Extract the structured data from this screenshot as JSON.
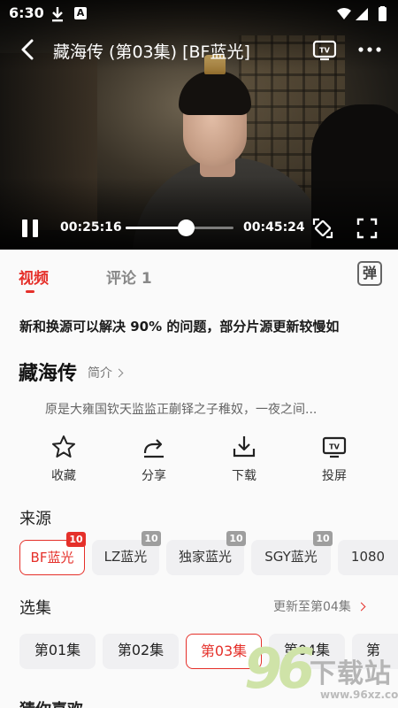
{
  "status_bar": {
    "time": "6:30",
    "icons": [
      "download-icon",
      "a-badge-icon",
      "wifi-icon",
      "signal-icon",
      "battery-icon"
    ]
  },
  "player": {
    "title": "藏海传 (第03集) [BF蓝光]",
    "current_time": "00:25:16",
    "total_time": "00:45:24",
    "progress_fraction": 0.556,
    "icons": [
      "back-icon",
      "tv-cast-icon",
      "more-icon",
      "pause-icon",
      "rotate-icon",
      "fullscreen-icon"
    ]
  },
  "tabs": {
    "video": "视频",
    "comment": "评论 1",
    "danmaku": "弹"
  },
  "notice": "新和换源可以解决 90% 的问题，部分片源更新较慢如",
  "show": {
    "title": "藏海传",
    "intro_label": "简介",
    "description": "原是大雍国钦天监监正蒯铎之子稚奴，一夜之间..."
  },
  "actions": [
    {
      "label": "收藏",
      "icon": "star-icon"
    },
    {
      "label": "分享",
      "icon": "share-icon"
    },
    {
      "label": "下载",
      "icon": "download-icon"
    },
    {
      "label": "投屏",
      "icon": "tv-icon"
    }
  ],
  "sources": {
    "label": "来源",
    "items": [
      {
        "name": "BF蓝光",
        "count": "10",
        "active": true
      },
      {
        "name": "LZ蓝光",
        "count": "10",
        "active": false
      },
      {
        "name": "独家蓝光",
        "count": "10",
        "active": false
      },
      {
        "name": "SGY蓝光",
        "count": "10",
        "active": false
      },
      {
        "name": "1080",
        "count": "",
        "active": false
      }
    ]
  },
  "episodes": {
    "label": "选集",
    "update_text": "更新至第04集",
    "items": [
      {
        "name": "第01集",
        "active": false
      },
      {
        "name": "第02集",
        "active": false
      },
      {
        "name": "第03集",
        "active": true
      },
      {
        "name": "第04集",
        "active": false
      },
      {
        "name": "第",
        "active": false
      }
    ]
  },
  "guess_label": "猜你喜欢",
  "watermark": {
    "number": "96",
    "text": "下载站",
    "url": "www.96xz.com"
  },
  "colors": {
    "accent": "#e5302a",
    "badge_gray": "#9e9e9e",
    "chip_bg": "#f0f0f2"
  }
}
